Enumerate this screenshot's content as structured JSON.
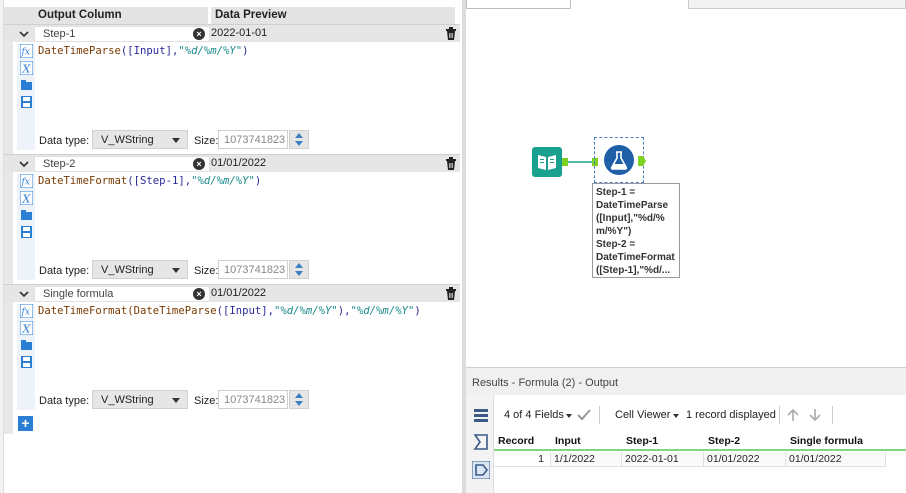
{
  "formula_panel": {
    "header": {
      "output_column": "Output Column",
      "data_preview": "Data Preview"
    },
    "rows": [
      {
        "name": "Step-1",
        "preview": "2022-01-01",
        "expr_func": "DateTimeParse",
        "expr_arg": "([Input],",
        "expr_str": "\"%d/%m/%Y\"",
        "expr_close": ")",
        "data_type_label": "Data type:",
        "data_type": "V_WString",
        "size_label": "Size:",
        "size": "1073741823"
      },
      {
        "name": "Step-2",
        "preview": "01/01/2022",
        "expr_func": "DateTimeFormat",
        "expr_arg": "([Step-1],",
        "expr_str": "\"%d/%m/%Y\"",
        "expr_close": ")",
        "data_type_label": "Data type:",
        "data_type": "V_WString",
        "size_label": "Size:",
        "size": "1073741823"
      },
      {
        "name": "Single formula",
        "preview": "01/01/2022",
        "expr_func": "DateTimeFormat(DateTimeParse",
        "expr_arg": "([Input],",
        "expr_str": "\"%d/%m/%Y\"",
        "expr_mid": "),",
        "expr_str2": "\"%d/%m/%Y\"",
        "expr_close": ")",
        "data_type_label": "Data type:",
        "data_type": "V_WString",
        "size_label": "Size:",
        "size": "1073741823"
      }
    ],
    "add_label": "+"
  },
  "canvas": {
    "annotation": "Step-1 =\nDateTimeParse\n([Input],\"%d/%\nm/%Y\")\nStep-2 =\nDateTimeFormat\n([Step-1],\"%d/..."
  },
  "results": {
    "title": "Results - Formula (2) - Output",
    "fields_label": "4 of 4 Fields",
    "viewer_label": "Cell Viewer",
    "records_label": "1 record displayed",
    "columns": [
      "Record",
      "Input",
      "Step-1",
      "Step-2",
      "Single formula"
    ],
    "rows": [
      [
        "1",
        "1/1/2022",
        "2022-01-01",
        "01/01/2022",
        "01/01/2022"
      ]
    ]
  },
  "colors": {
    "accent": "#2a7fd4",
    "tool_input": "#1aa08e",
    "tool_formula": "#1f5fa8",
    "grid_line": "#7fd47f"
  }
}
